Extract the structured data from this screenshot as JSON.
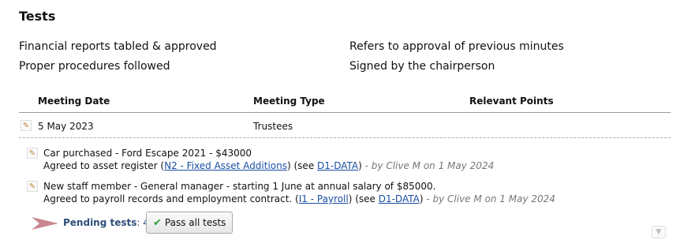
{
  "section_title": "Tests",
  "tests": [
    "Financial reports tabled & approved",
    "Refers to approval of previous minutes",
    "Proper procedures followed",
    "Signed by the chairperson"
  ],
  "table": {
    "headers": [
      "Meeting Date",
      "Meeting Type",
      "Relevant Points"
    ],
    "rows": [
      {
        "date": "5 May 2023",
        "type": "Trustees",
        "points": ""
      }
    ]
  },
  "notes": [
    {
      "line1": "Car purchased - Ford Escape 2021 - $43000",
      "line2_prefix": "Agreed to asset register (",
      "link1": "N2 - Fixed Asset Additions",
      "mid": ") (see ",
      "link2": "D1-DATA",
      "suffix": ")",
      "meta": " - by Clive M on 1 May 2024"
    },
    {
      "line1": "New staff member - General manager - starting 1 June at annual salary of $85000.",
      "line2_prefix": "Agreed to payroll records and employment contract. (",
      "link1": "I1 - Payroll",
      "mid": ") (see ",
      "link2": "D1-DATA",
      "suffix": ")",
      "meta": " - by Clive M on 1 May 2024"
    }
  ],
  "pending": {
    "label": "Pending tests",
    "count_text": ": 4",
    "button_label": "Pass all tests"
  },
  "icons": {
    "edit": "pencil-icon",
    "pending_arrow": "arrow-right-icon",
    "check": "check-icon",
    "scroll": "chevron-down-icon"
  },
  "colors": {
    "link": "#1a4fa0",
    "pending": "#2e4f7a",
    "check": "#2f9a3a",
    "arrow": "#c9868e"
  }
}
